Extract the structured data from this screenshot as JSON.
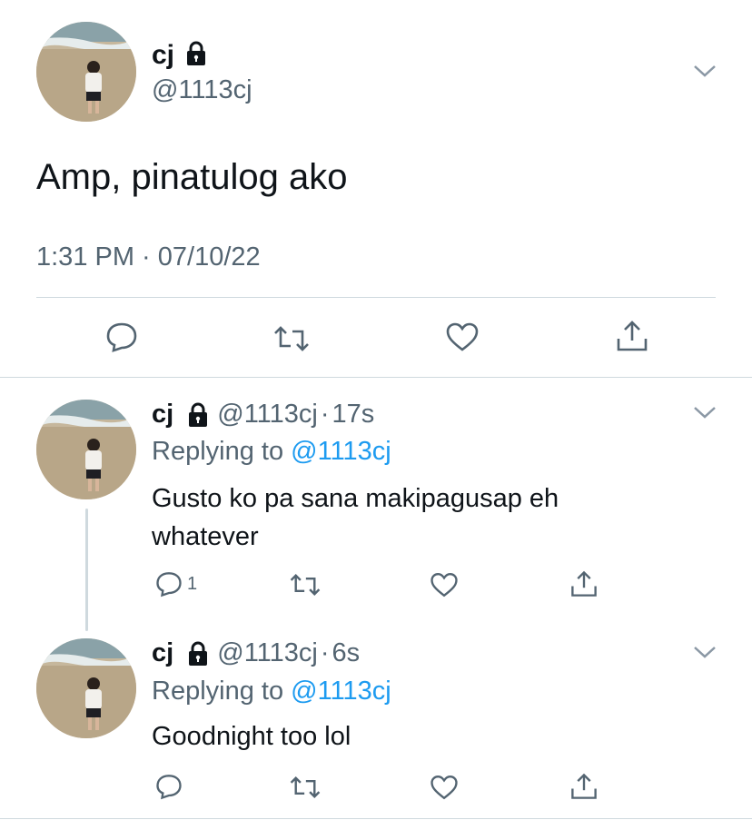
{
  "main_tweet": {
    "display_name": "cj",
    "handle": "@1113cj",
    "text": "Amp, pinatulog ako",
    "timestamp": "1:31 PM · 07/10/22"
  },
  "replies": [
    {
      "display_name": "cj",
      "handle": "@1113cj",
      "separator": "·",
      "time": "17s",
      "replying_prefix": "Replying to",
      "replying_handle": "@1113cj",
      "text_line1": "Gusto ko pa sana makipagusap eh",
      "text_line2": "whatever",
      "reply_count": "1"
    },
    {
      "display_name": "cj",
      "handle": "@1113cj",
      "separator": "·",
      "time": "6s",
      "replying_prefix": "Replying to",
      "replying_handle": "@1113cj",
      "text_line1": "Goodnight too lol",
      "reply_count": ""
    }
  ],
  "icons": [
    "lock-icon",
    "chevron-down-icon",
    "reply-icon",
    "retweet-icon",
    "like-icon",
    "share-icon"
  ],
  "colors": {
    "text": "#0f1419",
    "secondary": "#536471",
    "link": "#1d9bf0",
    "divider": "#cfd9de"
  }
}
